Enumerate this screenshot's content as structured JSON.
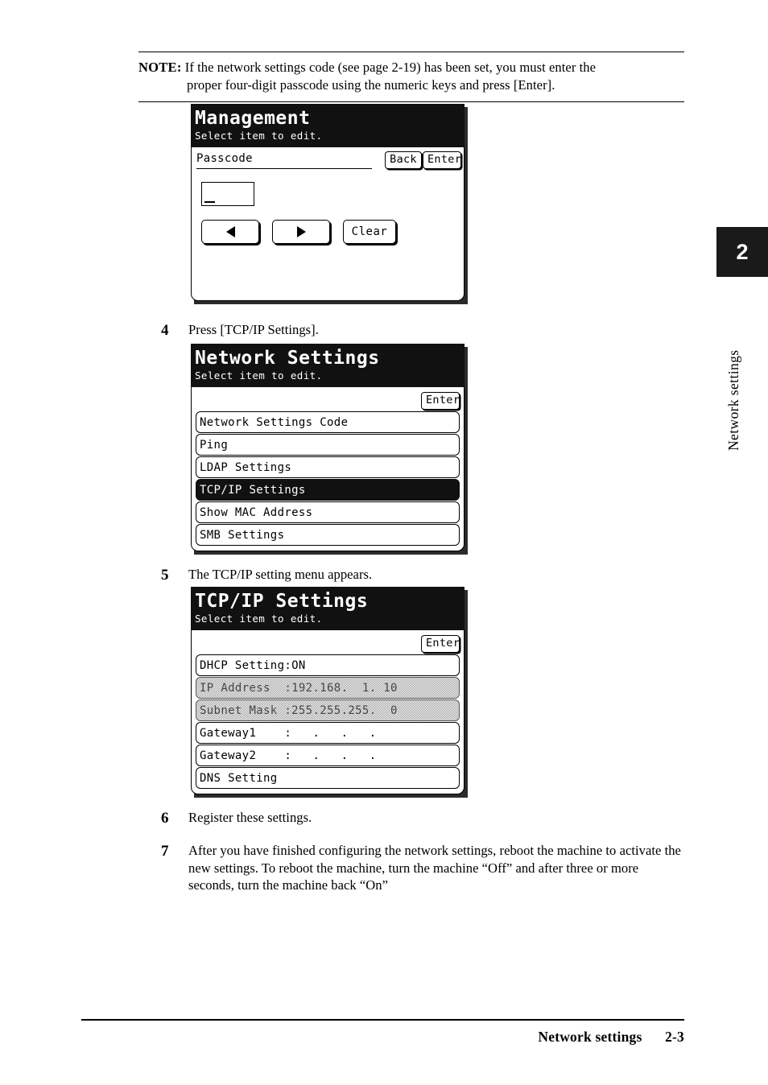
{
  "note": {
    "label": "NOTE:",
    "line1": "If the network settings code (see page 2-19) has been set, you must enter the",
    "line2": "proper four-digit passcode using the numeric keys and press [Enter]."
  },
  "panels": {
    "management": {
      "title": "Management",
      "subtitle": "Select item to edit.",
      "field_label": "Passcode",
      "field_value": "",
      "back_label": "Back",
      "enter_label": "Enter",
      "prev_icon": "triangle-left-icon",
      "next_icon": "triangle-right-icon",
      "clear_label": "Clear"
    },
    "network_settings": {
      "title": "Network Settings",
      "subtitle": "Select item to edit.",
      "enter_label": "Enter",
      "items": [
        {
          "label": "Network Settings Code",
          "state": "normal"
        },
        {
          "label": "Ping",
          "state": "normal"
        },
        {
          "label": "LDAP Settings",
          "state": "normal"
        },
        {
          "label": "TCP/IP Settings",
          "state": "selected"
        },
        {
          "label": "Show MAC Address",
          "state": "normal"
        },
        {
          "label": "SMB Settings",
          "state": "normal"
        }
      ]
    },
    "tcpip_settings": {
      "title": "TCP/IP Settings",
      "subtitle": "Select item to edit.",
      "enter_label": "Enter",
      "items": [
        {
          "label": "DHCP Setting:ON",
          "state": "normal"
        },
        {
          "label": "IP Address  :192.168.  1. 10",
          "state": "dimmed"
        },
        {
          "label": "Subnet Mask :255.255.255.  0",
          "state": "dimmed"
        },
        {
          "label": "Gateway1    :   .   .   .",
          "state": "normal"
        },
        {
          "label": "Gateway2    :   .   .   .",
          "state": "normal"
        },
        {
          "label": "DNS Setting",
          "state": "normal"
        }
      ]
    }
  },
  "steps": {
    "step4": {
      "num": "4",
      "text": "Press [TCP/IP Settings]."
    },
    "step5": {
      "num": "5",
      "text": "The TCP/IP setting menu appears."
    },
    "step6": {
      "num": "6",
      "text": "Register these settings."
    },
    "step7": {
      "num": "7",
      "text": "After you have finished configuring the network settings, reboot the machine to activate the new settings. To reboot the machine, turn the machine “Off” and after three or more seconds, turn the machine back “On”"
    }
  },
  "chapter": {
    "number": "2",
    "label": "Network settings"
  },
  "footer": {
    "section": "Network settings",
    "page": "2-3"
  }
}
